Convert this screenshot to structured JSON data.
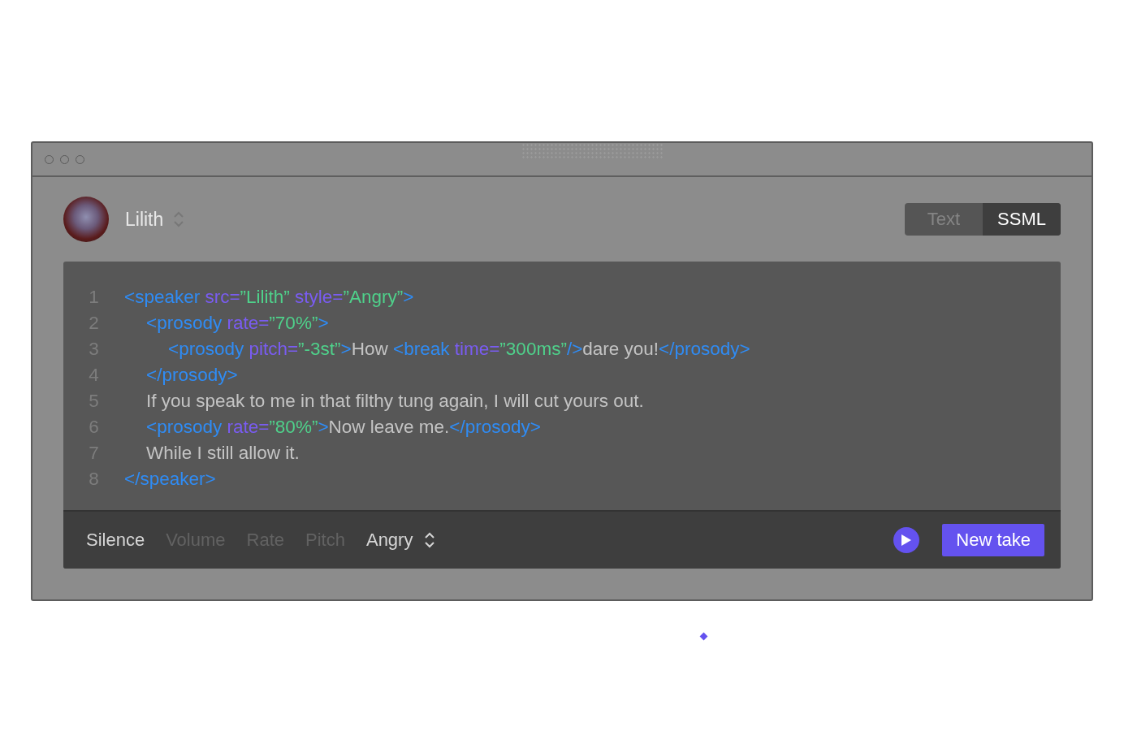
{
  "speaker": {
    "name": "Lilith"
  },
  "mode_tabs": [
    {
      "label": "Text",
      "selected": false
    },
    {
      "label": "SSML",
      "selected": true
    }
  ],
  "code_lines": [
    {
      "number": "1",
      "tokens": [
        {
          "kind": "tag",
          "text": "<speaker "
        },
        {
          "kind": "attr",
          "text": "src="
        },
        {
          "kind": "value",
          "text": "”Lilith”"
        },
        {
          "kind": "attr",
          "text": " style="
        },
        {
          "kind": "value",
          "text": "”Angry”"
        },
        {
          "kind": "tag",
          "text": ">"
        }
      ],
      "children": [
        {
          "number": "2",
          "tokens": [
            {
              "kind": "tag",
              "text": "<prosody "
            },
            {
              "kind": "attr",
              "text": "rate="
            },
            {
              "kind": "value",
              "text": "”70%”"
            },
            {
              "kind": "tag",
              "text": ">"
            }
          ],
          "children": [
            {
              "number": "3",
              "tokens": [
                {
                  "kind": "tag",
                  "text": "<prosody "
                },
                {
                  "kind": "attr",
                  "text": "pitch="
                },
                {
                  "kind": "value",
                  "text": "”-3st”"
                },
                {
                  "kind": "tag",
                  "text": ">"
                },
                {
                  "kind": "text",
                  "text": "How "
                },
                {
                  "kind": "tag",
                  "text": "<break "
                },
                {
                  "kind": "attr",
                  "text": "time="
                },
                {
                  "kind": "value",
                  "text": "”300ms”"
                },
                {
                  "kind": "tag",
                  "text": "/>"
                },
                {
                  "kind": "text",
                  "text": "dare you!"
                },
                {
                  "kind": "tag",
                  "text": "</prosody>"
                }
              ]
            }
          ]
        },
        {
          "number": "4",
          "tokens": [
            {
              "kind": "tag",
              "text": "</prosody>"
            }
          ]
        },
        {
          "number": "5",
          "tokens": [
            {
              "kind": "text",
              "text": "If you speak to me in that filthy tung again, I will cut yours out."
            }
          ]
        },
        {
          "number": "6",
          "tokens": [
            {
              "kind": "tag",
              "text": "<prosody "
            },
            {
              "kind": "attr",
              "text": "rate="
            },
            {
              "kind": "value",
              "text": "”80%”"
            },
            {
              "kind": "tag",
              "text": ">"
            },
            {
              "kind": "text",
              "text": "Now leave me."
            },
            {
              "kind": "tag",
              "text": "</prosody>"
            }
          ]
        },
        {
          "number": "7",
          "tokens": [
            {
              "kind": "text",
              "text": "While I still allow it."
            }
          ]
        }
      ]
    },
    {
      "number": "8",
      "tokens": [
        {
          "kind": "tag",
          "text": "</speaker>"
        }
      ]
    }
  ],
  "toolbar": [
    {
      "kind": "action",
      "label": "Silence",
      "disabled": false
    },
    {
      "kind": "action",
      "label": "Volume",
      "disabled": true
    },
    {
      "kind": "action",
      "label": "Rate",
      "disabled": true
    },
    {
      "kind": "action",
      "label": "Pitch",
      "disabled": true
    },
    {
      "kind": "select",
      "label": "Angry",
      "disabled": false
    }
  ],
  "new_take_button": "New take"
}
